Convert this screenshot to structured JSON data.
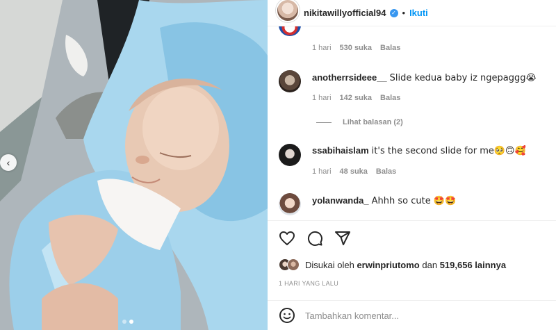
{
  "header": {
    "username": "nikitawillyofficial94",
    "separator": "•",
    "follow_label": "Ikuti"
  },
  "comments": [
    {
      "username": "",
      "text": "",
      "time": "1 hari",
      "likes": "530 suka",
      "reply_label": "Balas"
    },
    {
      "username": "anotherrsideee__",
      "text": "Slide kedua baby iz ngepaggg😭",
      "time": "1 hari",
      "likes": "142 suka",
      "reply_label": "Balas",
      "view_replies": "Lihat balasan (2)"
    },
    {
      "username": "ssabihaislam",
      "text": "it's the second slide for me🥺🙃🥰",
      "time": "1 hari",
      "likes": "48 suka",
      "reply_label": "Balas"
    },
    {
      "username": "yolanwanda_",
      "text": "Ahhh so cute 🤩🤩"
    }
  ],
  "likes": {
    "prefix": "Disukai oleh",
    "user": "erwinpriutomo",
    "middle": "dan",
    "count": "519,656 lainnya"
  },
  "post_date": "1 HARI YANG LALU",
  "add_comment": {
    "placeholder": "Tambahkan komentar..."
  },
  "icons": {
    "like": "heart-icon",
    "comment": "comment-icon",
    "share": "share-icon",
    "emoji": "smiley-icon",
    "prev": "chevron-left-icon"
  },
  "colors": {
    "accent": "#0095f6",
    "verified": "#3897f0",
    "muted": "#8e8e8e"
  },
  "carousel": {
    "slide_count": 2,
    "active_slide": 2
  }
}
